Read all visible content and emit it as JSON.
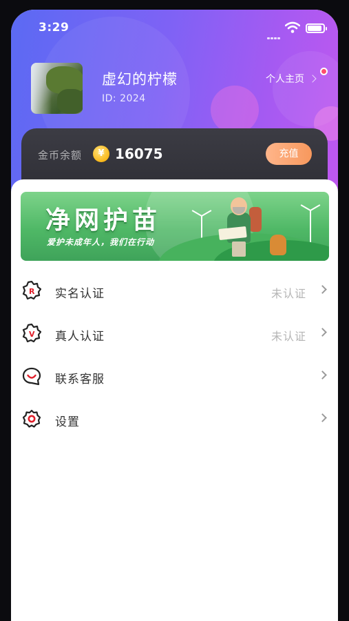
{
  "status_bar": {
    "time": "3:29"
  },
  "profile": {
    "username": "虚幻的柠檬",
    "user_id": "ID: 2024",
    "homepage_label": "个人主页"
  },
  "wallet": {
    "label": "金币余额",
    "coin_symbol": "¥",
    "amount": "16075",
    "recharge_label": "充值"
  },
  "banner": {
    "title": "净网护苗",
    "subtitle": "爱护未成年人，我们在行动"
  },
  "menu": [
    {
      "icon": "badge-r-icon",
      "label": "实名认证",
      "status": "未认证"
    },
    {
      "icon": "badge-v-icon",
      "label": "真人认证",
      "status": "未认证"
    },
    {
      "icon": "smile-chat-icon",
      "label": "联系客服",
      "status": ""
    },
    {
      "icon": "settings-gear-icon",
      "label": "设置",
      "status": ""
    }
  ],
  "colors": {
    "hero_start": "#5b6af3",
    "hero_end": "#c158ef",
    "accent_red": "#e0202b",
    "recharge": "#f7985d"
  }
}
